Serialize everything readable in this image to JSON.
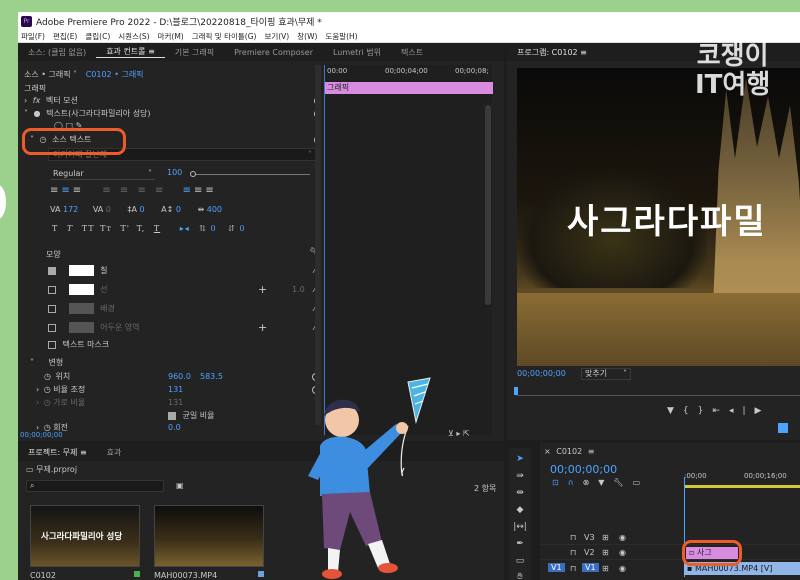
{
  "window": {
    "title": "Adobe Premiere Pro 2022 - D:\\블로그\\20220818_타이핑 효과\\무제 *"
  },
  "menu": [
    "파일(F)",
    "편집(E)",
    "클립(C)",
    "시퀀스(S)",
    "마커(M)",
    "그래픽 및 타이틀(G)",
    "보기(V)",
    "창(W)",
    "도움말(H)"
  ],
  "left_tabs": {
    "source": "소스: (클립 없음)",
    "effect_controls": "효과 컨트롤",
    "basic_graphics": "기본 그래픽",
    "premiere_composer": "Premiere Composer",
    "lumetri": "Lumetri 범위",
    "text": "텍스트"
  },
  "effect_controls": {
    "source_label": "소스 • 그래픽",
    "clip_label": "C0102 • 그래픽",
    "timecodes": [
      "00:00",
      "00;00;04;00",
      "00;00;08;"
    ],
    "graphic_bar": "그래픽",
    "graphic_header": "그래픽",
    "vector_motion": "벡터 모션",
    "text_layer": "텍스트(사그라다파밀리아 성당)",
    "source_text": "소스 텍스트",
    "font_name": "여기어때 잘난체",
    "font_style": "Regular",
    "font_size": "100",
    "tracking": "172",
    "kerning": "0",
    "leading": "0",
    "baseline": "0",
    "tsume": "400",
    "line_a": "0",
    "line_b": "0",
    "appearance_label": "모양",
    "fill": "칠",
    "stroke": "선",
    "stroke_width": "1.0",
    "background": "배경",
    "shadow": "어두운 영역",
    "text_mask": "텍스트 마스크",
    "transform_label": "변형",
    "position_label": "위치",
    "position_x": "960.0",
    "position_y": "583.5",
    "scale_label": "비율 조정",
    "scale_value": "131",
    "width_scale_label": "가로 비율",
    "width_scale_value": "131",
    "uniform_label": "균일 비율",
    "rotation_label": "회전",
    "rotation_value": "0.0",
    "bottom_timecode": "00;00;00;00"
  },
  "program": {
    "title": "프로그램: C0102",
    "overlay_text": "사그라다파밀",
    "timecode": "00;00;00;00",
    "fit": "맞추기"
  },
  "project": {
    "tab_project": "프로젝트: 무제",
    "tab_effects": "효과",
    "file": "무제.prproj",
    "count": "2 항목",
    "items": [
      {
        "name": "C0102",
        "thumb_text": "사그라다파밀리아 성당"
      },
      {
        "name": "MAH00073.MP4",
        "thumb_text": ""
      }
    ]
  },
  "timeline": {
    "sequence": "C0102",
    "timecode": "00;00;00;00",
    "ruler": [
      ":00;00",
      "00;00;16;00"
    ],
    "tracks": [
      "V3",
      "V2",
      "V1"
    ],
    "v2_clip": "사그",
    "v1_clip": "MAH00073.MP4 [V]"
  },
  "watermark": {
    "line1": "코쟁이",
    "line2": "IT여행"
  },
  "colors": {
    "accent_blue": "#4ea3ff",
    "clip_pink": "#d98be0",
    "highlight": "#f05b2a",
    "bg_green": "#9bd08d"
  }
}
